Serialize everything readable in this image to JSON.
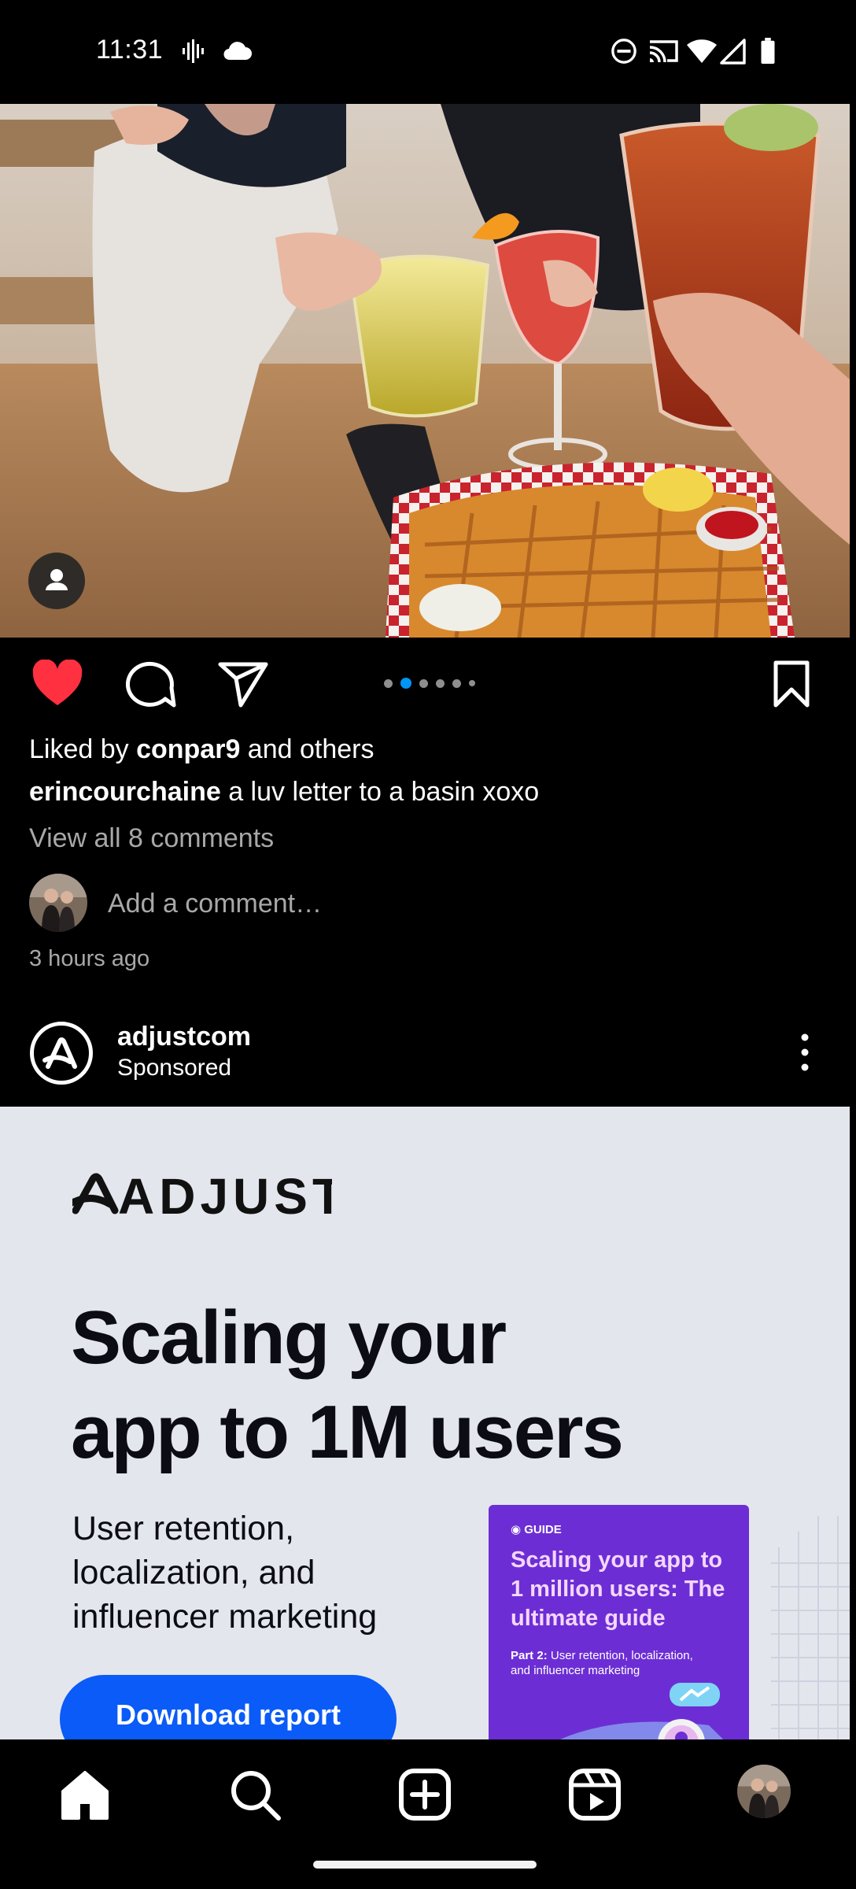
{
  "status_bar": {
    "time": "11:31",
    "icons": [
      "voicemail-wave-icon",
      "cloud-icon",
      "do-not-disturb-icon",
      "cast-icon",
      "wifi-icon",
      "signal-icon",
      "battery-icon"
    ]
  },
  "post": {
    "photo_description_icon": "user-tag-icon",
    "carousel": {
      "total": 6,
      "active_index": 1
    },
    "liked_by_prefix": "Liked by ",
    "liked_by_user": "conpar9",
    "liked_by_suffix": " and others",
    "caption_user": "erincourchaine",
    "caption_text": " a luv letter to a basin xoxo",
    "view_comments": "View all 8 comments",
    "comment_placeholder": "Add a comment…",
    "timestamp": "3 hours ago",
    "liked": true
  },
  "sponsored": {
    "account": "adjustcom",
    "label": "Sponsored"
  },
  "ad": {
    "brand": "ADJUST",
    "headline_line1": "Scaling your",
    "headline_line2": "app to 1M users",
    "subline1": "User retention,",
    "subline2": "localization, and",
    "subline3": "influencer marketing",
    "cta": "Download report",
    "guide_tag": "GUIDE",
    "guide_title": "Scaling your app to 1 million users: The ultimate guide",
    "guide_sub_bold": "Part 2:",
    "guide_sub": " User retention, localization, and influencer marketing"
  },
  "colors": {
    "like_red": "#ff3040",
    "carousel_active": "#0095f6",
    "ad_background": "#e4e6ee",
    "cta_blue": "#0a5bf7",
    "guide_purple": "#6c2ed4"
  },
  "bottom_nav": [
    "home-icon",
    "search-icon",
    "create-icon",
    "reels-icon",
    "profile-avatar"
  ]
}
